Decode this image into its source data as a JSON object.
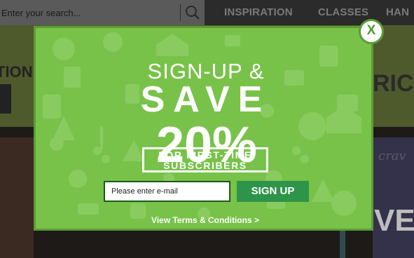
{
  "header": {
    "search": {
      "placeholder": "Enter your search..."
    },
    "nav": [
      {
        "label": "INSPIRATION"
      },
      {
        "label": "CLASSES"
      },
      {
        "label": "HAN"
      }
    ]
  },
  "background": {
    "left_text": "TION",
    "right_text": "RIC",
    "lower_right_text": "VE",
    "script_text": "crav"
  },
  "modal": {
    "headline_line1": "SIGN-UP &",
    "headline_line2": "SAVE",
    "headline_line3": "20%",
    "badge_line1": "FOR FIRST-TIME",
    "badge_line2": "SUBSCRIBERS",
    "email_placeholder": "Please enter e-mail",
    "signup_label": "SIGN UP",
    "terms_label": "View Terms & Conditions >",
    "close_label": "X"
  },
  "colors": {
    "modal_bg": "#78c24a",
    "modal_border": "#5a9d33",
    "signup_button": "#2d9449",
    "topbar": "#2b2b2b"
  },
  "icons": [
    "search-icon",
    "close-icon"
  ]
}
